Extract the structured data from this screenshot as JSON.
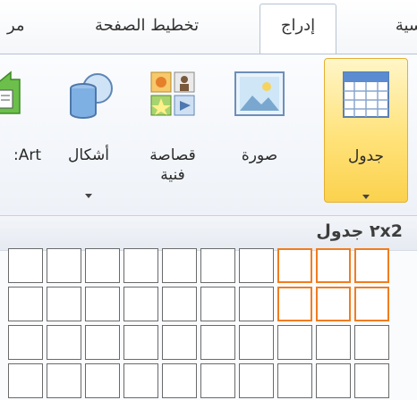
{
  "tabs": [
    {
      "label": "سية",
      "active": false
    },
    {
      "label": "إدراج",
      "active": true
    },
    {
      "label": "تخطيط الصفحة",
      "active": false
    },
    {
      "label": "مر",
      "active": false
    }
  ],
  "ribbon": {
    "table_button": {
      "label": "جدول",
      "icon": "table-icon"
    },
    "picture_button": {
      "label": "صورة",
      "icon": "picture-icon"
    },
    "clipart_button": {
      "label_line1": "قصاصة",
      "label_line2": "فنية",
      "icon": "clipart-icon"
    },
    "shapes_button": {
      "label": "أشكال",
      "icon": "shapes-icon"
    },
    "smartart_button": {
      "label": ":Art",
      "icon": "smartart-icon"
    }
  },
  "table_dropdown": {
    "title": "٢x2 جدول",
    "columns": 10,
    "rows": 4,
    "selected_columns": 3,
    "selected_rows": 2,
    "selection_color": "#f07d20"
  },
  "colors": {
    "active_button_bg": "#ffe27a",
    "active_button_border": "#e3b033",
    "selection_border": "#f07d20",
    "cell_border": "#6a6a6a"
  }
}
